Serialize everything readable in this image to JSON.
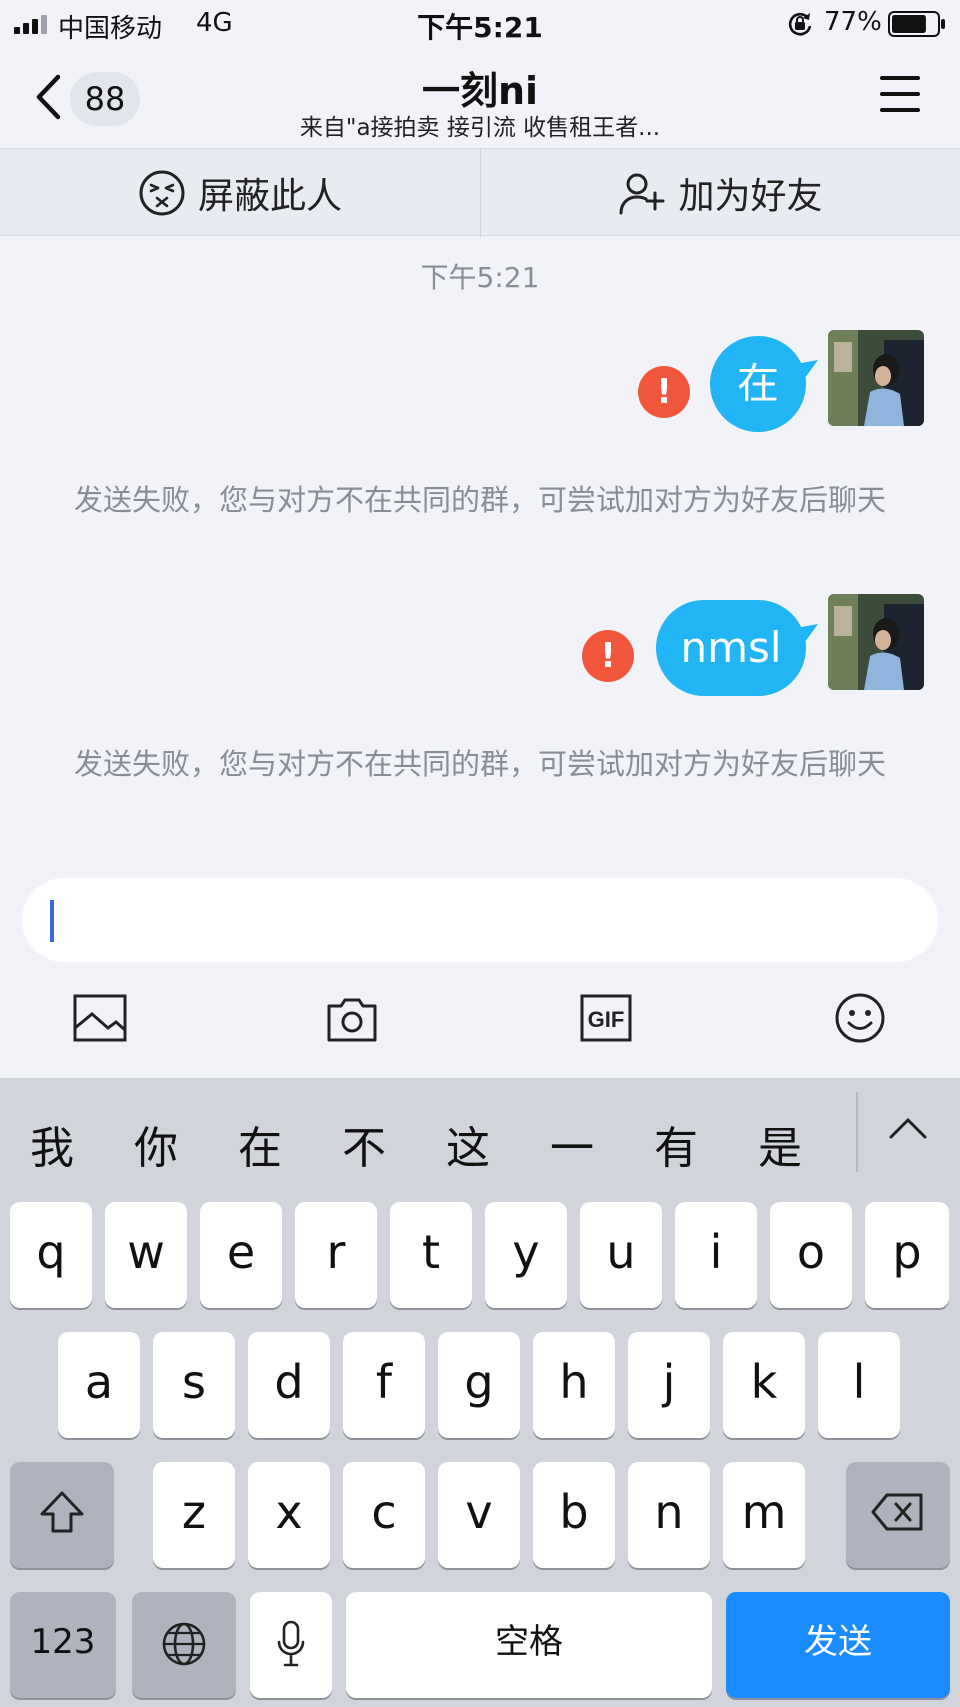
{
  "status_bar": {
    "carrier": "中国移动",
    "network": "4G",
    "time": "下午5:21",
    "battery_percent": "77%",
    "battery_level": 0.77,
    "icons": [
      "signal-icon",
      "orientation-lock-icon",
      "battery-icon"
    ]
  },
  "nav": {
    "unread_count": "88",
    "title": "一刻ni",
    "subtitle": "来自\"a接拍卖 接引流 收售租王者...",
    "icons": [
      "chevron-left-icon",
      "menu-icon"
    ]
  },
  "actions": {
    "block_label": "屏蔽此人",
    "add_friend_label": "加为好友",
    "icons": [
      "dizzy-face-icon",
      "add-user-icon"
    ]
  },
  "chat": {
    "timestamp": "下午5:21",
    "messages": [
      {
        "text": "在",
        "status": "failed",
        "note": "发送失败，您与对方不在共同的群，可尝试加对方为好友后聊天"
      },
      {
        "text": "nmsl",
        "status": "failed",
        "note": "发送失败，您与对方不在共同的群，可尝试加对方为好友后聊天"
      }
    ]
  },
  "input": {
    "value": "",
    "toolbar_icons": [
      "image-icon",
      "camera-icon",
      "gif-icon",
      "emoji-icon"
    ]
  },
  "keyboard": {
    "candidates": [
      "我",
      "你",
      "在",
      "不",
      "这",
      "一",
      "有",
      "是"
    ],
    "row1": [
      "q",
      "w",
      "e",
      "r",
      "t",
      "y",
      "u",
      "i",
      "o",
      "p"
    ],
    "row2": [
      "a",
      "s",
      "d",
      "f",
      "g",
      "h",
      "j",
      "k",
      "l"
    ],
    "row3": [
      "z",
      "x",
      "c",
      "v",
      "b",
      "n",
      "m"
    ],
    "numbers_label": "123",
    "space_label": "空格",
    "send_label": "发送",
    "send_color": "#1a8cff",
    "icons": [
      "chevron-up-icon",
      "shift-icon",
      "delete-icon",
      "globe-icon",
      "microphone-icon"
    ]
  }
}
